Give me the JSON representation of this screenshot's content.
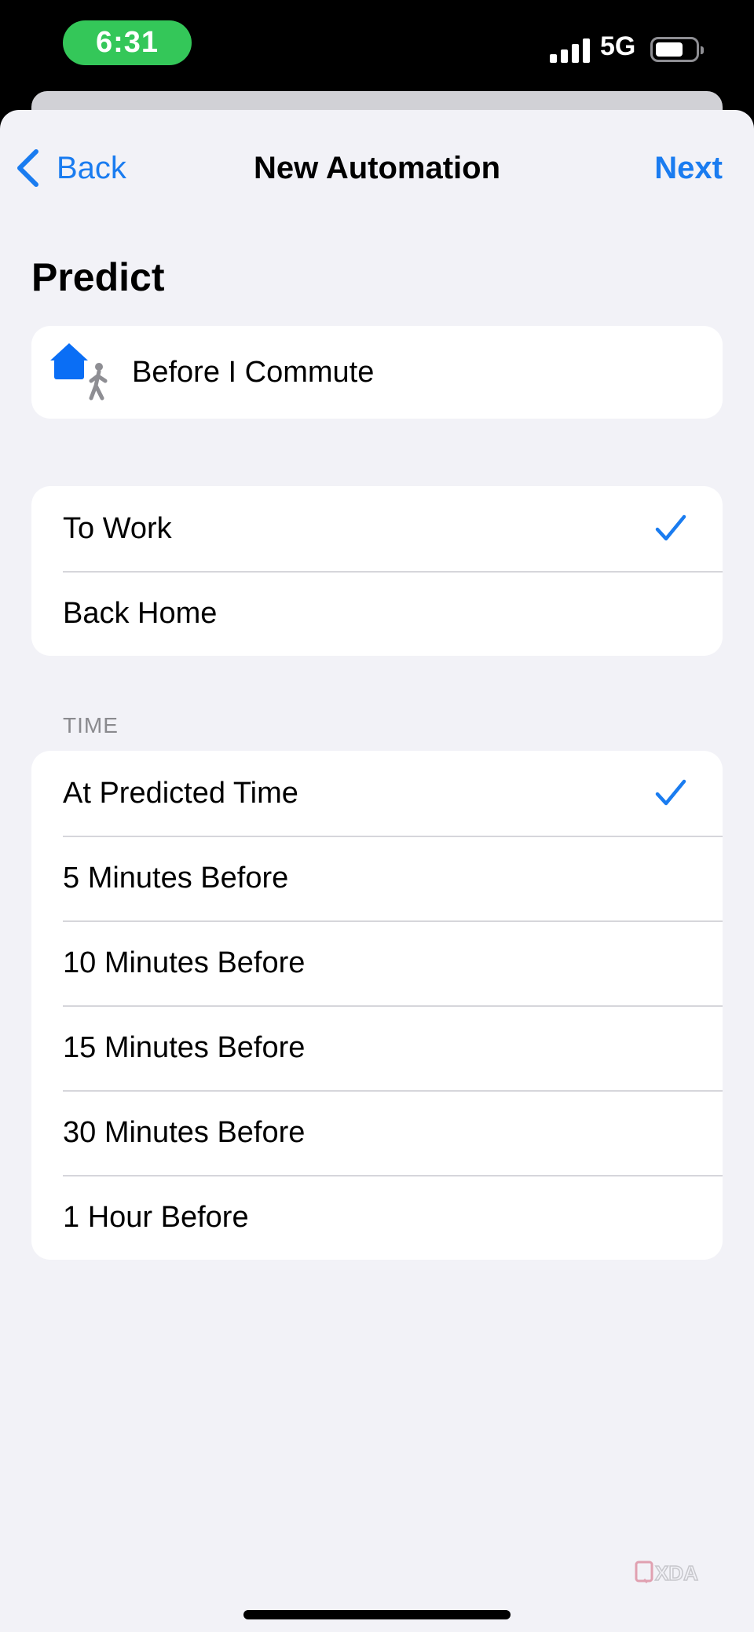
{
  "status_bar": {
    "time": "6:31",
    "network": "5G",
    "colors": {
      "time_pill": "#34c759"
    }
  },
  "nav": {
    "back_label": "Back",
    "title": "New Automation",
    "next_label": "Next",
    "accent_color": "#1a7cf0"
  },
  "section_title": "Predict",
  "trigger": {
    "icon": "home-commute-icon",
    "label": "Before I Commute"
  },
  "destinations": {
    "items": [
      {
        "label": "To Work",
        "selected": true
      },
      {
        "label": "Back Home",
        "selected": false
      }
    ]
  },
  "time": {
    "header": "TIME",
    "items": [
      {
        "label": "At Predicted Time",
        "selected": true
      },
      {
        "label": "5 Minutes Before",
        "selected": false
      },
      {
        "label": "10 Minutes Before",
        "selected": false
      },
      {
        "label": "15 Minutes Before",
        "selected": false
      },
      {
        "label": "30 Minutes Before",
        "selected": false
      },
      {
        "label": "1 Hour Before",
        "selected": false
      }
    ]
  },
  "watermark": "XDA"
}
